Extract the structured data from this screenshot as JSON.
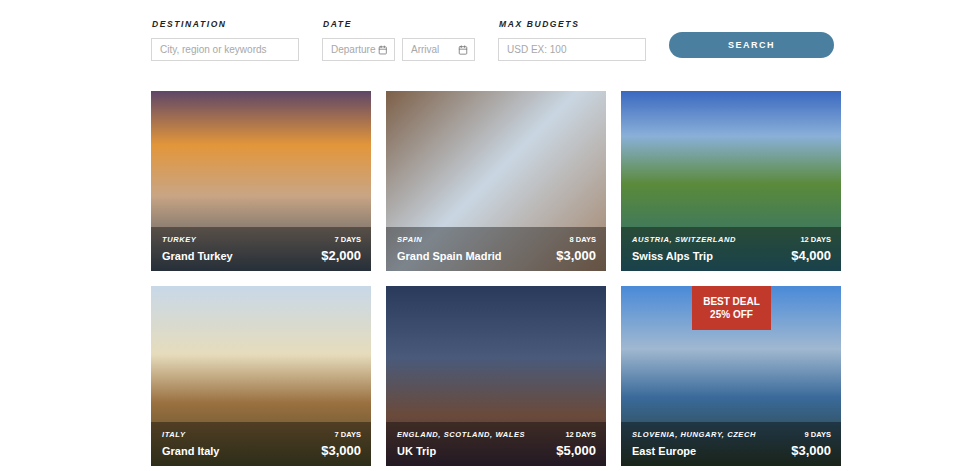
{
  "search": {
    "fields": [
      {
        "label": "DESTINATION",
        "inputs": [
          {
            "placeholder": "City, region or keywords",
            "kind": "text"
          }
        ]
      },
      {
        "label": "DATE",
        "inputs": [
          {
            "placeholder": "Departure",
            "kind": "date"
          },
          {
            "placeholder": "Arrival",
            "kind": "date"
          }
        ]
      },
      {
        "label": "MAX BUDGETS",
        "inputs": [
          {
            "placeholder": "USD EX: 100",
            "kind": "text"
          }
        ]
      }
    ],
    "button": "SEARCH"
  },
  "trips": [
    {
      "country": "TURKEY",
      "title": "Grand Turkey",
      "days": "7 DAYS",
      "price": "$2,000",
      "badge": null
    },
    {
      "country": "SPAIN",
      "title": "Grand Spain Madrid",
      "days": "8 DAYS",
      "price": "$3,000",
      "badge": null
    },
    {
      "country": "AUSTRIA, SWITZERLAND",
      "title": "Swiss Alps Trip",
      "days": "12 DAYS",
      "price": "$4,000",
      "badge": null
    },
    {
      "country": "ITALY",
      "title": "Grand Italy",
      "days": "7 DAYS",
      "price": "$3,000",
      "badge": null
    },
    {
      "country": "ENGLAND, SCOTLAND, WALES",
      "title": "UK Trip",
      "days": "12 DAYS",
      "price": "$5,000",
      "badge": null
    },
    {
      "country": "SLOVENIA, HUNGARY, CZECH",
      "title": "East Europe",
      "days": "9 DAYS",
      "price": "$3,000",
      "badge": {
        "line1": "BEST DEAL",
        "line2": "25% OFF"
      }
    }
  ]
}
